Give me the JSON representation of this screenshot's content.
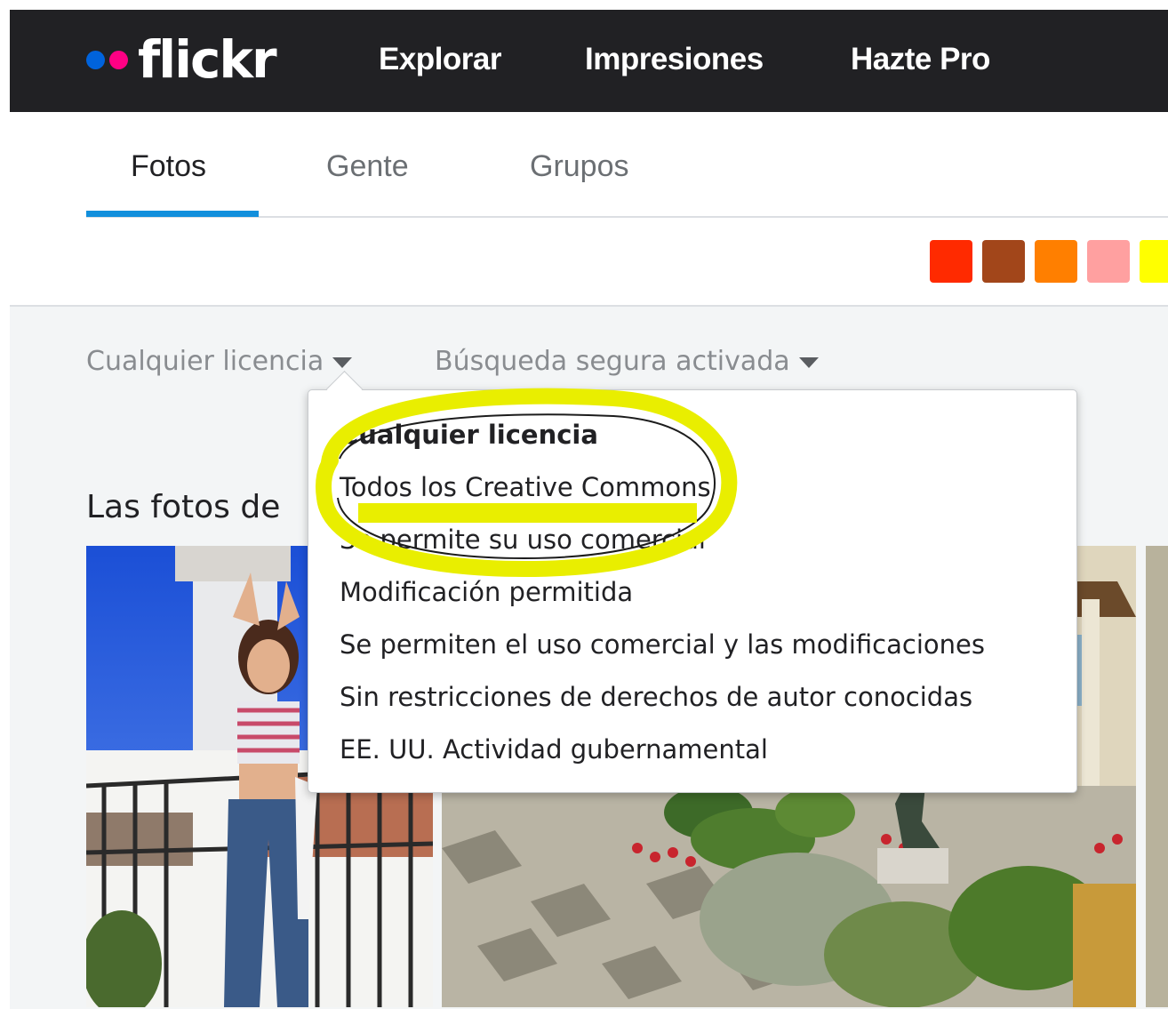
{
  "header": {
    "logo_text": "flickr",
    "nav": [
      "Explorar",
      "Impresiones",
      "Hazte Pro"
    ]
  },
  "tabs": [
    "Fotos",
    "Gente",
    "Grupos"
  ],
  "active_tab": "Fotos",
  "color_swatches": [
    "#ff2a00",
    "#a2461a",
    "#ff7f00",
    "#ffa0a0",
    "#ffff00"
  ],
  "filters": {
    "license": "Cualquier licencia",
    "safe_search": "Búsqueda segura activada"
  },
  "section_title": "Las fotos de",
  "license_menu": {
    "items": [
      "Cualquier licencia",
      "Todos los Creative Commons",
      "Se permite su uso comercial",
      "Modificación permitida",
      "Se permiten el uso comercial y las modificaciones",
      "Sin restricciones de derechos de autor conocidas",
      "EE. UU. Actividad gubernamental"
    ],
    "selected": "Cualquier licencia"
  },
  "annotation": {
    "highlight_color": "#e9ee00"
  }
}
